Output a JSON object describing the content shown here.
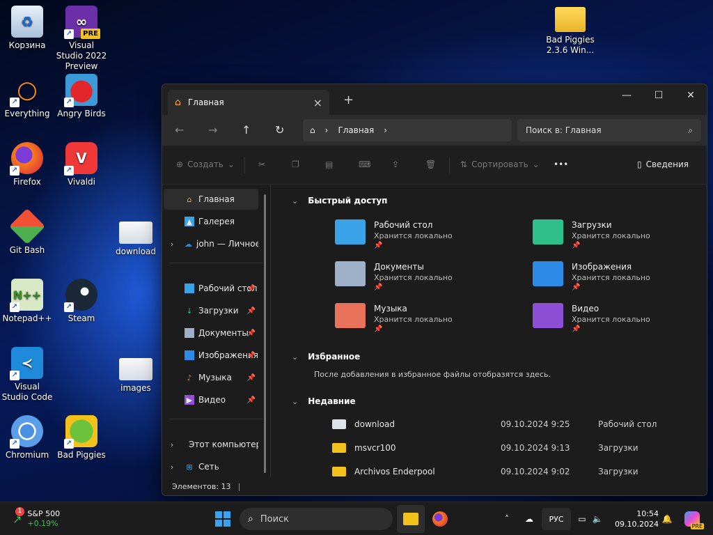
{
  "desktop": {
    "icons": [
      {
        "label": "Корзина"
      },
      {
        "label": "Visual Studio 2022 Preview"
      },
      {
        "label": "Everything"
      },
      {
        "label": "Angry Birds"
      },
      {
        "label": "Firefox"
      },
      {
        "label": "Vivaldi"
      },
      {
        "label": "Git Bash"
      },
      {
        "label": "download"
      },
      {
        "label": "Notepad++"
      },
      {
        "label": "Steam"
      },
      {
        "label": "Visual Studio Code"
      },
      {
        "label": "images"
      },
      {
        "label": "Chromium"
      },
      {
        "label": "Bad Piggies"
      },
      {
        "label": "Bad Piggies 2.3.6 Win..."
      }
    ],
    "vs_badge": "PRE"
  },
  "explorer": {
    "tab_title": "Главная",
    "breadcrumb": "Главная",
    "search_placeholder": "Поиск в: Главная",
    "commands": {
      "create": "Создать",
      "sort": "Сортировать",
      "more": "•••",
      "details": "Сведения"
    },
    "sidebar": [
      {
        "label": "Главная"
      },
      {
        "label": "Галерея"
      },
      {
        "label": "john — Личное"
      },
      {
        "label": "Рабочий стол"
      },
      {
        "label": "Загрузки"
      },
      {
        "label": "Документы"
      },
      {
        "label": "Изображения"
      },
      {
        "label": "Музыка"
      },
      {
        "label": "Видео"
      },
      {
        "label": "Этот компьютер"
      },
      {
        "label": "Сеть"
      }
    ],
    "sections": {
      "quick_access": "Быстрый доступ",
      "favorites": "Избранное",
      "favorites_note": "После добавления в избранное файлы отобразятся здесь.",
      "recent": "Недавние"
    },
    "quick_access": [
      {
        "name": "Рабочий стол",
        "sub": "Хранится локально",
        "color": "#3aa3e8"
      },
      {
        "name": "Загрузки",
        "sub": "Хранится локально",
        "color": "#2fbf8c"
      },
      {
        "name": "Документы",
        "sub": "Хранится локально",
        "color": "#9fb1c9"
      },
      {
        "name": "Изображения",
        "sub": "Хранится локально",
        "color": "#2d8be8"
      },
      {
        "name": "Музыка",
        "sub": "Хранится локально",
        "color": "#e8735a"
      },
      {
        "name": "Видео",
        "sub": "Хранится локально",
        "color": "#8d4fd6"
      }
    ],
    "recent": [
      {
        "name": "download",
        "date": "09.10.2024 9:25",
        "location": "Рабочий стол"
      },
      {
        "name": "msvcr100",
        "date": "09.10.2024 9:13",
        "location": "Загрузки"
      },
      {
        "name": "Archivos Enderpool",
        "date": "09.10.2024 9:02",
        "location": "Загрузки"
      }
    ],
    "status": "Элементов: 13"
  },
  "taskbar": {
    "widget_name": "S&P 500",
    "widget_value": "+0.19%",
    "widget_badge": "1",
    "search_label": "Поиск",
    "lang": "РУС",
    "time": "10:54",
    "date": "09.10.2024",
    "pre_badge": "PRE"
  }
}
